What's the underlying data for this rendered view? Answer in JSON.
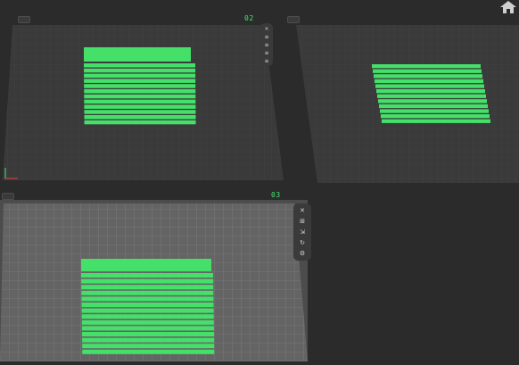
{
  "viewports": [
    {
      "id": "top-left",
      "label": "",
      "active": false
    },
    {
      "id": "top-right",
      "label": "02",
      "active": false
    },
    {
      "id": "bottom-left",
      "label": "03",
      "active": true
    }
  ],
  "side_toolbar_top": {
    "tools": [
      {
        "icon": "close-icon",
        "glyph": "×"
      },
      {
        "icon": "lines-icon",
        "glyph": "≡"
      },
      {
        "icon": "lines-icon",
        "glyph": "≡"
      },
      {
        "icon": "lines-icon",
        "glyph": "≡"
      },
      {
        "icon": "lines-icon",
        "glyph": "≡"
      }
    ]
  },
  "side_toolbar_bottom": {
    "tools": [
      {
        "icon": "close-icon",
        "glyph": "✕"
      },
      {
        "icon": "grid-icon",
        "glyph": "⊞"
      },
      {
        "icon": "move-icon",
        "glyph": "⇲"
      },
      {
        "icon": "rotate-icon",
        "glyph": "↻"
      },
      {
        "icon": "settings-icon",
        "glyph": "⚙"
      }
    ]
  },
  "colors": {
    "model_green": "#45e06a",
    "grid_dark": "#3a3a3a",
    "grid_light": "#6a6a6a",
    "label_green": "#3ee870"
  }
}
